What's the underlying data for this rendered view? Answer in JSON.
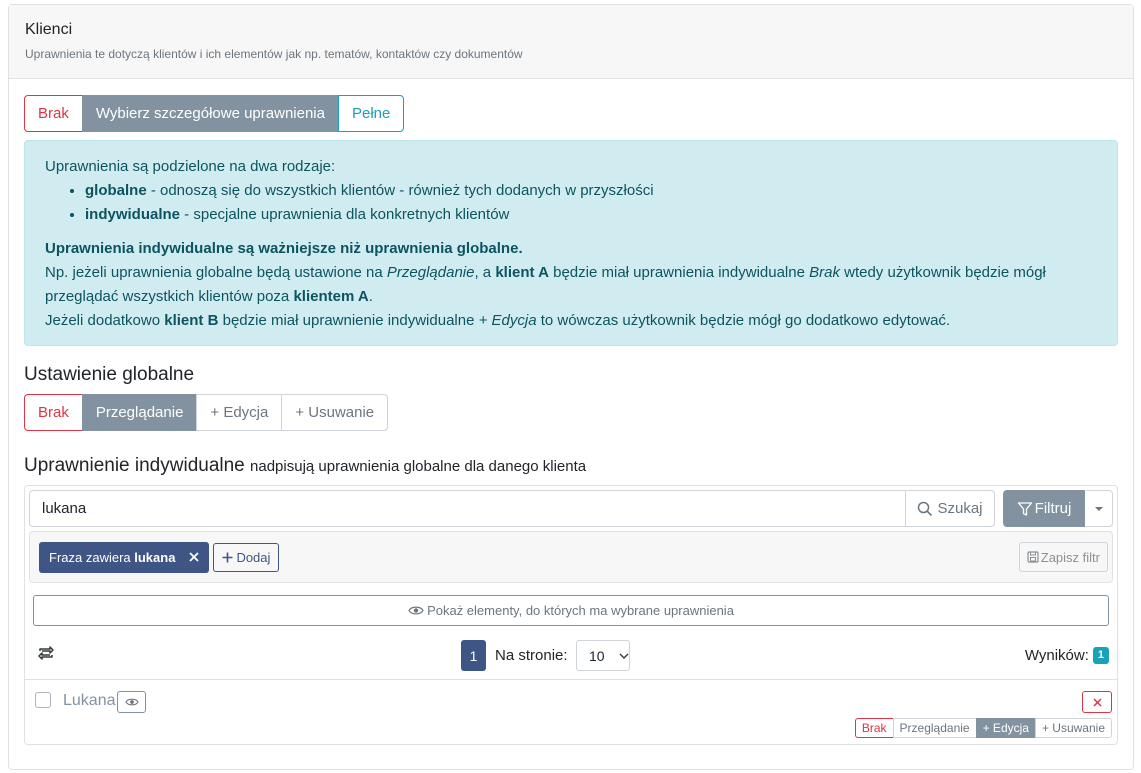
{
  "card": {
    "title": "Klienci",
    "subtitle": "Uprawnienia te dotyczą klientów i ich elementów jak np. tematów, kontaktów czy dokumentów"
  },
  "mode": {
    "options": [
      "Brak",
      "Wybierz szczegółowe uprawnienia",
      "Pełne"
    ],
    "selected": "Wybierz szczegółowe uprawnienia"
  },
  "info": {
    "intro": "Uprawnienia są podzielone na dwa rodzaje:",
    "types": [
      {
        "term": "globalne",
        "desc": " - odnoszą się do wszystkich klientów - również tych dodanych w przyszłości"
      },
      {
        "term": "indywidualne",
        "desc": " - specjalne uprawnienia dla konkretnych klientów"
      }
    ],
    "important": "Uprawnienia indywidualne są ważniejsze niż uprawnienia globalne.",
    "example1": {
      "p1": "Np. jeżeli uprawnienia globalne będą ustawione na ",
      "em1": "Przeglądanie",
      "p2": ", a ",
      "b1": "klient A",
      "p3": " będzie miał uprawnienia indywidualne ",
      "em2": "Brak",
      "p4": " wtedy użytkownik będzie mógł przeglądać wszystkich klientów poza ",
      "b2": "klientem A",
      "p5": "."
    },
    "example2": {
      "p1": "Jeżeli dodatkowo ",
      "b1": "klient B",
      "p2": " będzie miał uprawnienie indywidualne ",
      "em1": "+ Edycja",
      "p3": " to wówczas użytkownik będzie mógł go dodatkowo edytować."
    }
  },
  "global": {
    "title": "Ustawienie globalne",
    "options": [
      "Brak",
      "Przeglądanie",
      "+ Edycja",
      "+ Usuwanie"
    ],
    "selected": "Przeglądanie"
  },
  "individual": {
    "title": "Uprawnienie indywidualne",
    "subtitle": "nadpisują uprawnienia globalne dla danego klienta",
    "search": {
      "value": "lukana",
      "button": "Szukaj"
    },
    "filter_button": "Filtruj",
    "chip": {
      "prefix": "Fraza zawiera ",
      "value": "lukana"
    },
    "add_button": "Dodaj",
    "save_filter": "Zapisz filtr",
    "show_button": "Pokaż elementy, do których ma wybrane uprawnienia",
    "pager": {
      "page": "1",
      "per_page_label": "Na stronie:",
      "per_page": "10",
      "results_label": "Wyników:",
      "results": "1"
    },
    "items": [
      {
        "name": "Lukana",
        "options": [
          "Brak",
          "Przeglądanie",
          "+ Edycja",
          "+ Usuwanie"
        ],
        "selected": "+ Edycja"
      }
    ]
  },
  "colors": {
    "accent": "#8392a1",
    "primary": "#3e5585",
    "danger": "#dc3545",
    "info": "#17a2b8",
    "alert_bg": "#d1ecf1"
  },
  "icons": {
    "search": "search-icon",
    "filter": "filter-icon",
    "caret": "chevron-down-icon",
    "close": "close-icon",
    "plus": "plus-icon",
    "save": "save-icon",
    "eye": "eye-icon",
    "refresh": "refresh-icon",
    "remove": "close-icon"
  }
}
